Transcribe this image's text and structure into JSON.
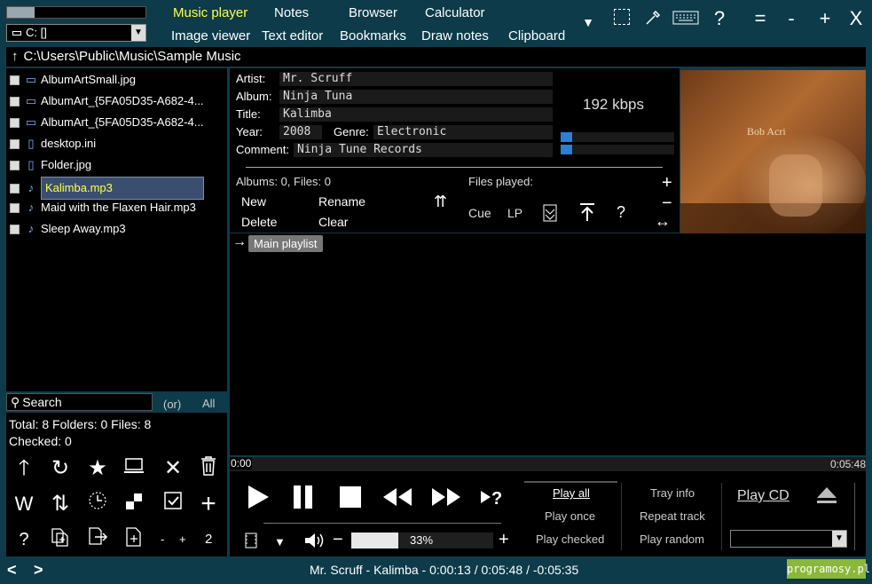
{
  "top": {
    "progress_fraction": 0.2,
    "drive": "C: []",
    "menu_row1": [
      "Music player",
      "Notes",
      "Browser",
      "Calculator"
    ],
    "menu_row2": [
      "Image viewer",
      "Text editor",
      "Bookmarks",
      "Draw notes",
      "Clipboard"
    ],
    "icons": [
      "dropdown-icon",
      "selection-icon",
      "eyedropper-icon",
      "keyboard-icon",
      "help-icon",
      "menu-icon",
      "minimize-icon",
      "maximize-icon",
      "close-icon"
    ],
    "help_symbol": "?",
    "menu_symbol": "=",
    "minus_symbol": "-",
    "plus_symbol": "+",
    "close_symbol": "X"
  },
  "path": "C:\\Users\\Public\\Music\\Sample Music",
  "path_up_symbol": "↑",
  "files": [
    {
      "name": "AlbumArtSmall.jpg",
      "icon": "image-icon",
      "selected": false
    },
    {
      "name": "AlbumArt_{5FA05D35-A682-4...",
      "icon": "image-icon",
      "selected": false
    },
    {
      "name": "AlbumArt_{5FA05D35-A682-4...",
      "icon": "image-icon",
      "selected": false
    },
    {
      "name": "desktop.ini",
      "icon": "document-icon",
      "selected": false
    },
    {
      "name": "Folder.jpg",
      "icon": "document-icon",
      "selected": false
    },
    {
      "name": "Kalimba.mp3",
      "icon": "music-note-icon",
      "selected": true
    },
    {
      "name": "Maid with the Flaxen Hair.mp3",
      "icon": "music-note-icon",
      "selected": false
    },
    {
      "name": "Sleep Away.mp3",
      "icon": "music-note-icon",
      "selected": false
    }
  ],
  "search": {
    "placeholder": "Search",
    "or_label": "(or)",
    "all_label": "All"
  },
  "stats": {
    "line1": "Total: 8   Folders: 0   Files: 8",
    "line2": "Checked: 0"
  },
  "left_buttons": {
    "w": "W",
    "question": "?",
    "minus": "-",
    "plus": "+",
    "count": "2"
  },
  "tags": {
    "artist_label": "Artist:",
    "artist": "Mr. Scruff",
    "album_label": "Album:",
    "album": "Ninja Tuna",
    "title_label": "Title:",
    "title": "Kalimba",
    "year_label": "Year:",
    "year": "2008",
    "genre_label": "Genre:",
    "genre": "Electronic",
    "comment_label": "Comment:",
    "comment": "Ninja Tune Records"
  },
  "bitrate": "192 kbps",
  "meters": [
    0.1,
    0.1
  ],
  "playlist_panel": {
    "albums_files": "Albums: 0,  Files: 0",
    "files_played": "Files played:",
    "new": "New",
    "rename": "Rename",
    "delete": "Delete",
    "clear": "Clear",
    "cue": "Cue",
    "lp": "LP",
    "help": "?",
    "plus": "+",
    "minus": "−",
    "resize": "↔",
    "main_playlist": "Main playlist"
  },
  "album_art": {
    "artist_text": "Bob Acri"
  },
  "time": {
    "elapsed": "0:00",
    "total": "0:05:48",
    "progress_fraction": 0.0
  },
  "transport": {
    "volume_percent": 33,
    "volume_label": "33%",
    "play_all": "Play all",
    "play_once": "Play once",
    "play_checked": "Play checked",
    "tray_info": "Tray info",
    "repeat_track": "Repeat track",
    "play_random": "Play random",
    "play_cd": "Play CD",
    "minus": "−",
    "plus": "+"
  },
  "status": {
    "text": "Mr. Scruff - Kalimba - 0:00:13 / 0:05:48 / -0:05:35",
    "watermark": "programosy.pl",
    "back": "<",
    "forward": ">"
  },
  "colors": {
    "accent": "#ffff4a",
    "frame": "#0d3b4a",
    "meter": "#2b7fd6",
    "watermark_bg": "#8ab838"
  }
}
